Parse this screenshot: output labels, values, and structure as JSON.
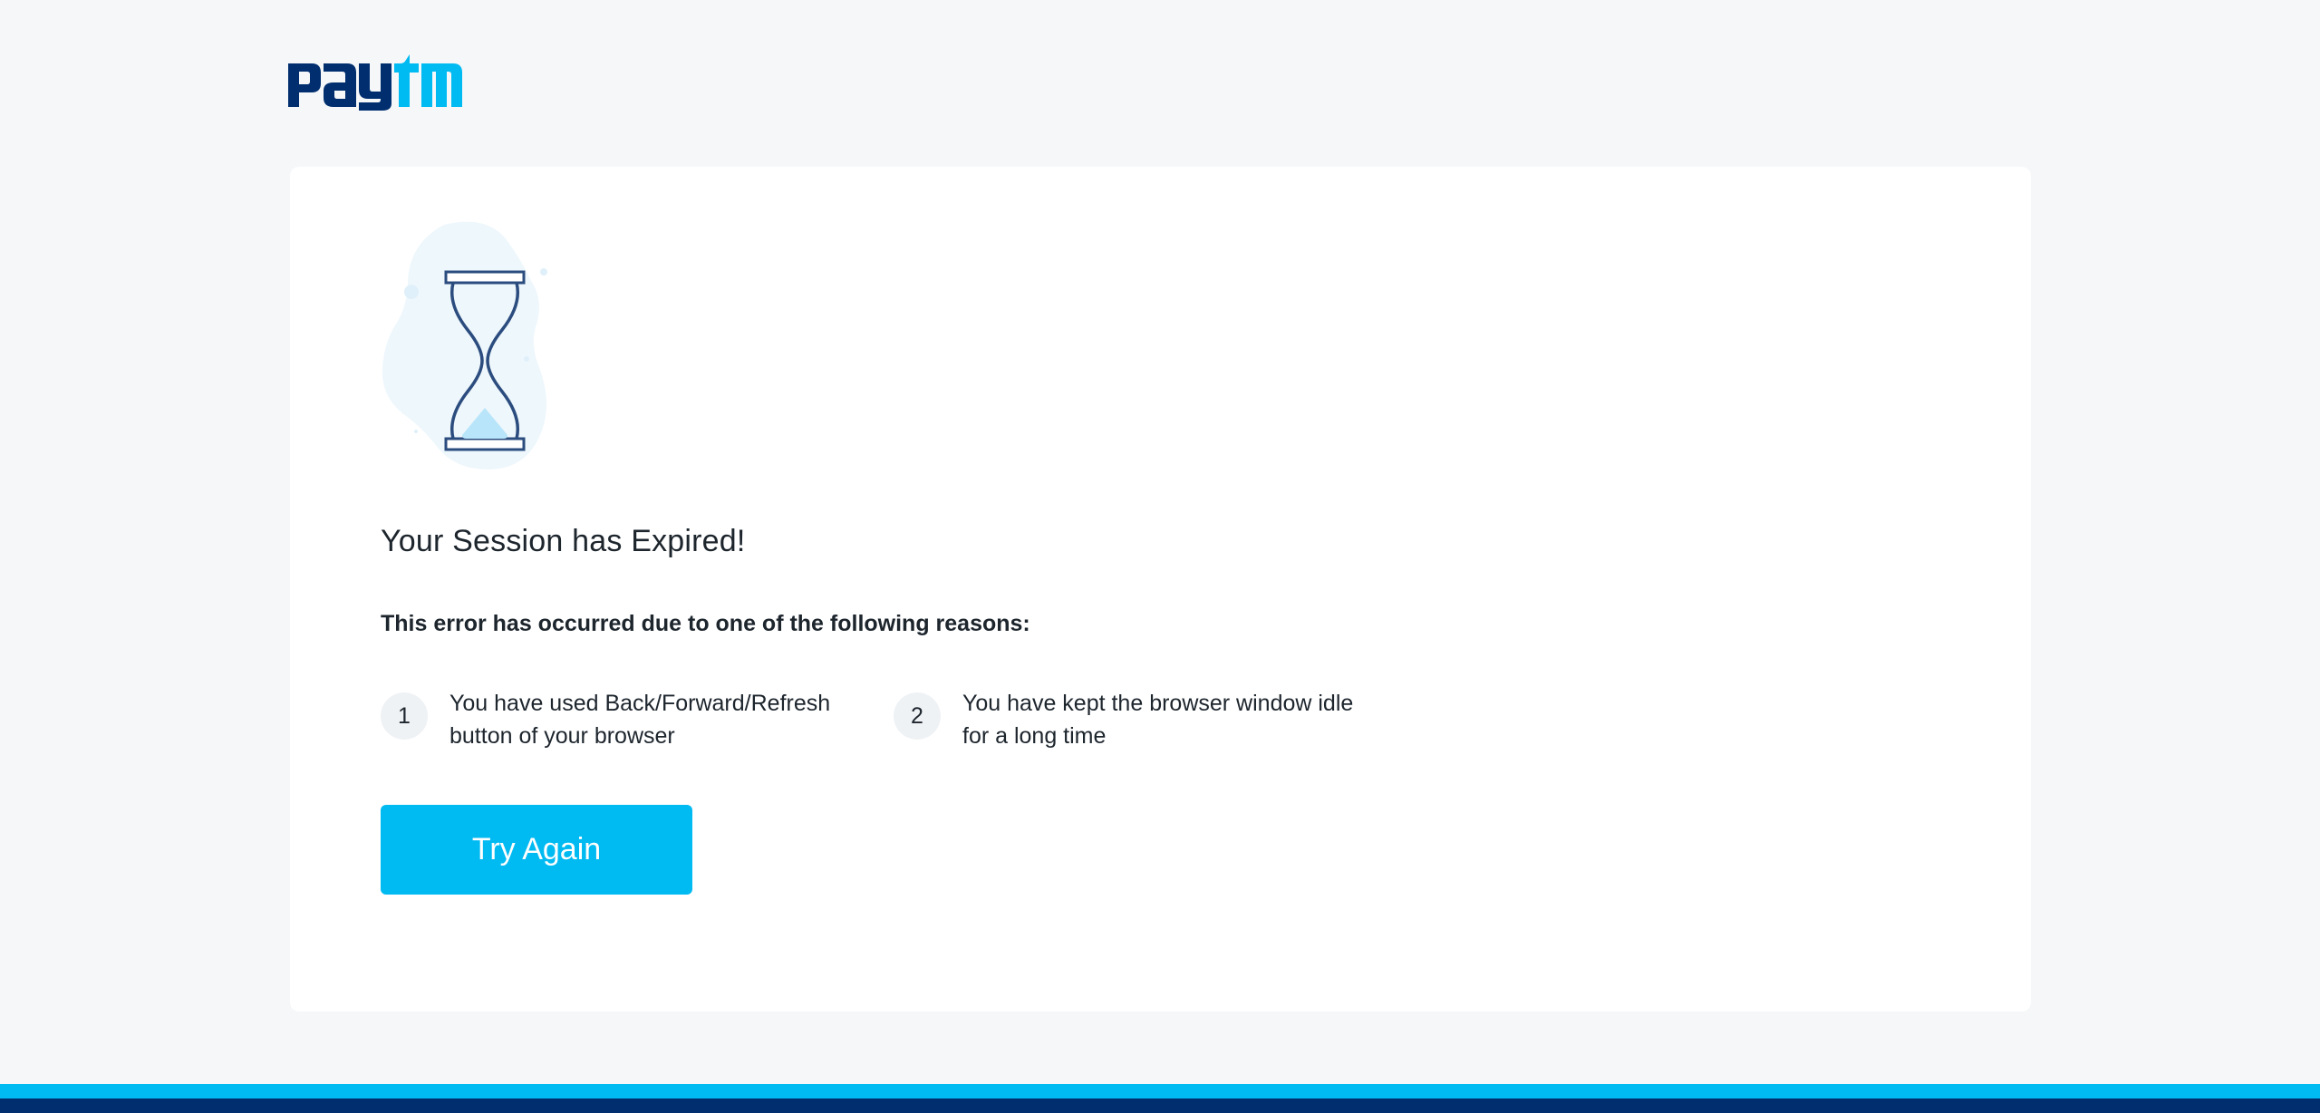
{
  "brand": {
    "logo_text": "paytm",
    "logo_text_pay": "pay",
    "logo_text_tm": "tm",
    "colors": {
      "navy": "#002e6e",
      "sky": "#00baf2"
    }
  },
  "error": {
    "illustration_icon": "hourglass-icon",
    "title": "Your Session has Expired!",
    "reasons_heading": "This error has occurred due to one of the following reasons:",
    "reasons": [
      {
        "number": "1",
        "text": "You have used Back/Forward/Refresh button of your browser"
      },
      {
        "number": "2",
        "text": "You have kept the browser window idle for a long time"
      }
    ],
    "retry_button_label": "Try Again"
  },
  "colors": {
    "page_background": "#f5f7f9",
    "card_background": "#ffffff",
    "button_primary": "#00baf2",
    "footer_light": "#00baf2",
    "footer_dark": "#002e6e",
    "text_primary": "#1d252d"
  }
}
